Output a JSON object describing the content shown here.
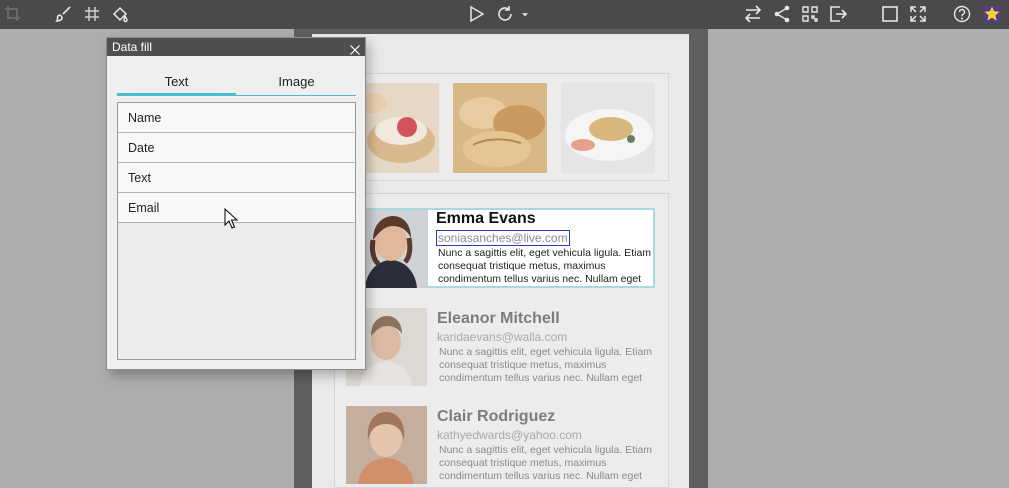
{
  "toolbar": {
    "left_icons": [
      "crop-icon",
      "brush-icon",
      "grid-icon",
      "paint-bucket-icon"
    ],
    "center_icons": [
      "play-icon",
      "refresh-icon",
      "dropdown-arrow-icon"
    ],
    "right_icons": [
      "swap-icon",
      "share-icon",
      "qr-code-icon",
      "export-icon",
      "window-icon",
      "fullscreen-icon",
      "help-icon",
      "star-icon"
    ]
  },
  "dialog": {
    "title": "Data fill",
    "tabs": [
      {
        "label": "Text"
      },
      {
        "label": "Image"
      }
    ],
    "active_tab": "Text",
    "fields": [
      {
        "label": "Name"
      },
      {
        "label": "Date"
      },
      {
        "label": "Text"
      },
      {
        "label": "Email"
      }
    ]
  },
  "people": [
    {
      "name": "Emma Evans",
      "email": "soniasanches@live.com",
      "desc": "Nunc a sagittis elit, eget vehicula ligula. Etiam consequat tristique metus, maximus condimentum tellus varius nec. Nullam eget"
    },
    {
      "name": "Eleanor Mitchell",
      "email": "karidaevans@walla.com",
      "desc": "Nunc a sagittis elit, eget vehicula ligula. Etiam consequat tristique metus, maximus condimentum tellus varius nec. Nullam eget"
    },
    {
      "name": "Clair Rodriguez",
      "email": "kathyedwards@yahoo.com",
      "desc": "Nunc a sagittis elit, eget vehicula ligula. Etiam consequat tristique metus, maximus condimentum tellus varius nec. Nullam eget"
    }
  ],
  "colors": {
    "accent": "#4cbccb",
    "toolbar": "#4a4a4a",
    "selection_border": "#2a3bb7"
  }
}
